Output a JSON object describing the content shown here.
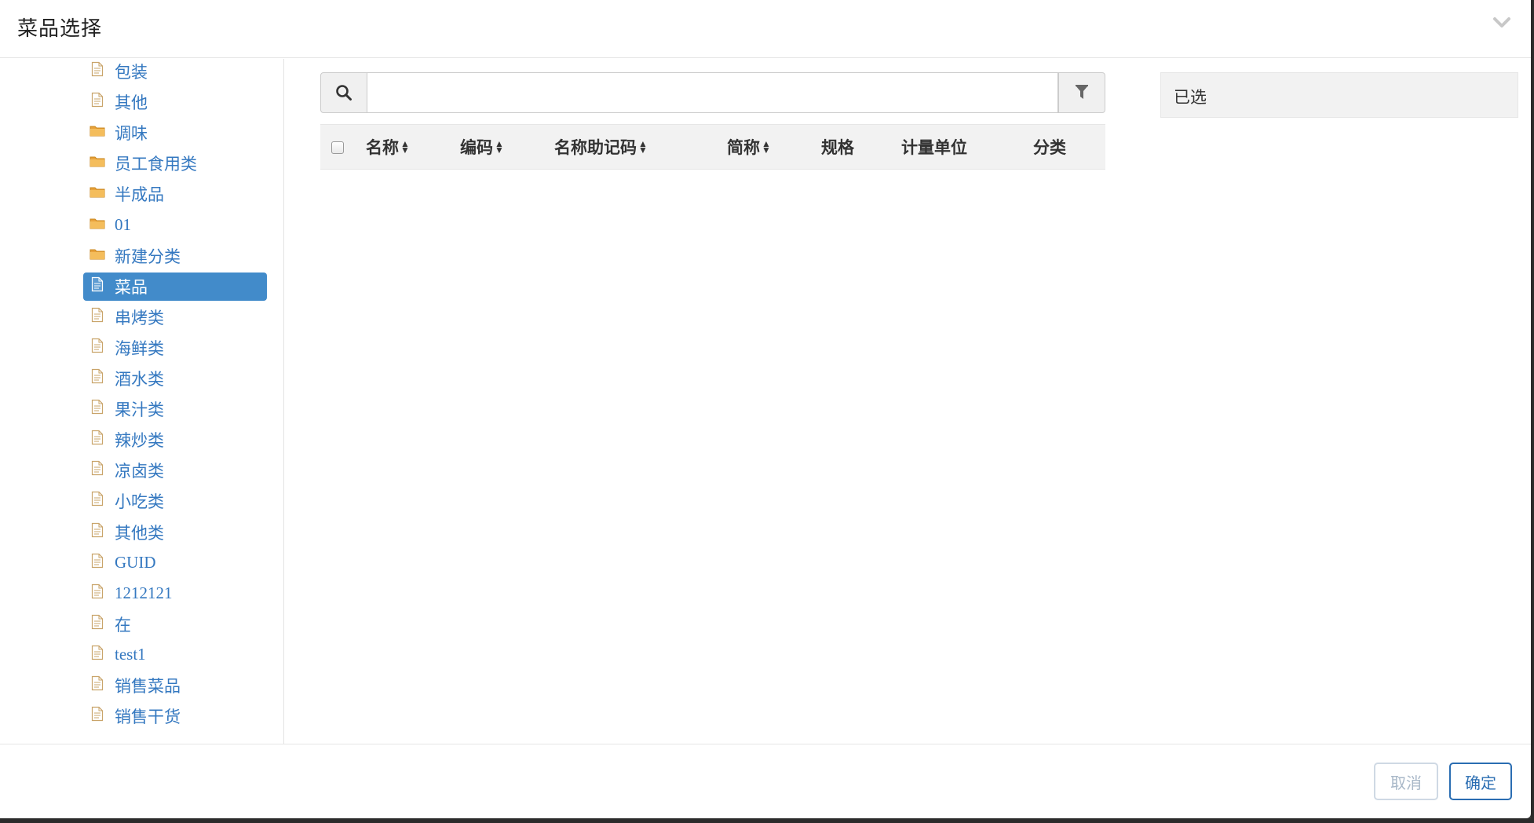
{
  "modal": {
    "title": "菜品选择",
    "collapse_icon": "chevron-down-icon"
  },
  "tree": {
    "items": [
      {
        "label": "包装",
        "icon": "document-icon",
        "selected": false
      },
      {
        "label": "其他",
        "icon": "document-icon",
        "selected": false
      },
      {
        "label": "调味",
        "icon": "folder-icon",
        "selected": false
      },
      {
        "label": "员工食用类",
        "icon": "folder-icon",
        "selected": false
      },
      {
        "label": "半成品",
        "icon": "folder-icon",
        "selected": false
      },
      {
        "label": "01",
        "icon": "folder-icon",
        "selected": false
      },
      {
        "label": "新建分类",
        "icon": "folder-icon",
        "selected": false
      },
      {
        "label": "菜品",
        "icon": "document-icon",
        "selected": true
      },
      {
        "label": "串烤类",
        "icon": "document-icon",
        "selected": false
      },
      {
        "label": "海鲜类",
        "icon": "document-icon",
        "selected": false
      },
      {
        "label": "酒水类",
        "icon": "document-icon",
        "selected": false
      },
      {
        "label": "果汁类",
        "icon": "document-icon",
        "selected": false
      },
      {
        "label": "辣炒类",
        "icon": "document-icon",
        "selected": false
      },
      {
        "label": "凉卤类",
        "icon": "document-icon",
        "selected": false
      },
      {
        "label": "小吃类",
        "icon": "document-icon",
        "selected": false
      },
      {
        "label": "其他类",
        "icon": "document-icon",
        "selected": false
      },
      {
        "label": "GUID",
        "icon": "document-icon",
        "selected": false
      },
      {
        "label": "1212121",
        "icon": "document-icon",
        "selected": false
      },
      {
        "label": "在",
        "icon": "document-icon",
        "selected": false
      },
      {
        "label": "test1",
        "icon": "document-icon",
        "selected": false
      },
      {
        "label": "销售菜品",
        "icon": "document-icon",
        "selected": false
      },
      {
        "label": "销售干货",
        "icon": "document-icon",
        "selected": false
      }
    ]
  },
  "search": {
    "value": "",
    "placeholder": "",
    "search_icon": "search-icon",
    "filter_icon": "filter-icon"
  },
  "table": {
    "select_all_checked": false,
    "columns": [
      {
        "label": "名称",
        "sortable": true
      },
      {
        "label": "编码",
        "sortable": true
      },
      {
        "label": "名称助记码",
        "sortable": true
      },
      {
        "label": "简称",
        "sortable": true
      },
      {
        "label": "规格",
        "sortable": false
      },
      {
        "label": "计量单位",
        "sortable": false
      },
      {
        "label": "分类",
        "sortable": false
      }
    ],
    "rows": []
  },
  "selected_panel": {
    "title": "已选"
  },
  "footer": {
    "cancel_label": "取消",
    "ok_label": "确定"
  },
  "colors": {
    "accent": "#428bca",
    "link": "#3478c0",
    "folder": "#e8a23c",
    "document": "#c9a46a"
  }
}
